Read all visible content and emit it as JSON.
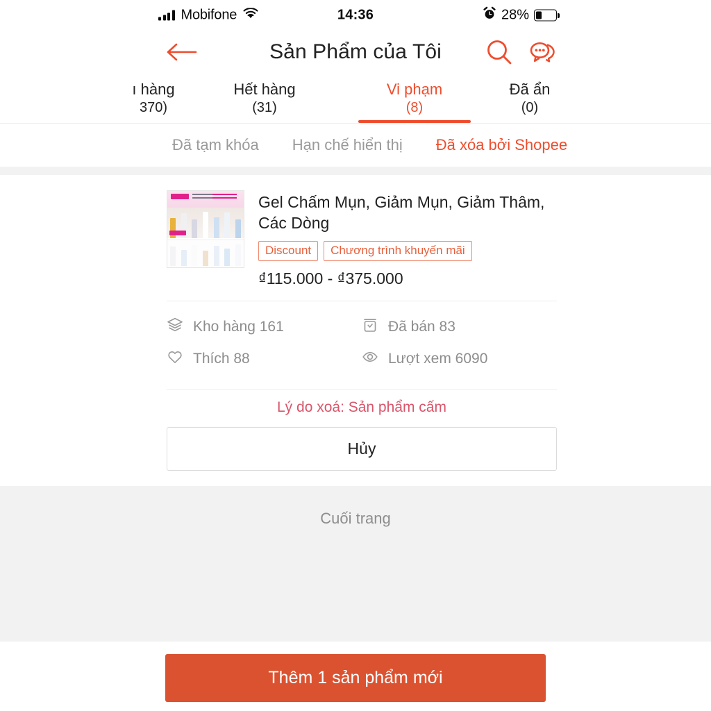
{
  "status_bar": {
    "carrier": "Mobifone",
    "time": "14:36",
    "battery_percent": "28%",
    "signal_icon": "signal-bars-icon",
    "wifi_icon": "wifi-icon",
    "alarm_icon": "alarm-clock-icon",
    "battery_icon": "battery-icon"
  },
  "header": {
    "title": "Sản Phẩm của Tôi",
    "back_icon": "back-arrow-icon",
    "search_icon": "search-icon",
    "chat_icon": "chat-bubble-icon",
    "accent_color": "#ee4d2d"
  },
  "tabs": [
    {
      "label": "ı hàng",
      "count": "370)",
      "active": false
    },
    {
      "label": "Hết hàng",
      "count": "(31)",
      "active": false
    },
    {
      "label": "Vi phạm",
      "count": "(8)",
      "active": true
    },
    {
      "label": "Đã ẩn",
      "count": "(0)",
      "active": false
    }
  ],
  "subtabs": [
    {
      "label": "Đã tạm khóa",
      "active": false
    },
    {
      "label": "Hạn chế hiển thị",
      "active": false
    },
    {
      "label": "Đã xóa bởi Shopee",
      "active": true
    }
  ],
  "product": {
    "title": "Gel Chấm Mụn, Giảm Mụn, Giảm Thâm, Các Dòng",
    "badges": [
      "Discount",
      "Chương trình khuyến mãi"
    ],
    "price": "₫115.000 - ₫375.000",
    "thumbnail_name": "product-thumbnail",
    "stats": [
      {
        "icon": "layers-icon",
        "label": "Kho hàng 161"
      },
      {
        "icon": "box-icon",
        "label": "Đã bán 83"
      },
      {
        "icon": "heart-icon",
        "label": "Thích 88"
      },
      {
        "icon": "eye-icon",
        "label": "Lượt xem 6090"
      }
    ],
    "reason": "Lý do xoá: Sản phẩm cấm",
    "reason_color": "#d8566b",
    "cancel_label": "Hủy"
  },
  "end_of_page": "Cuối trang",
  "footer": {
    "add_product_label": "Thêm 1 sản phẩm mới",
    "button_color": "#db5230"
  }
}
